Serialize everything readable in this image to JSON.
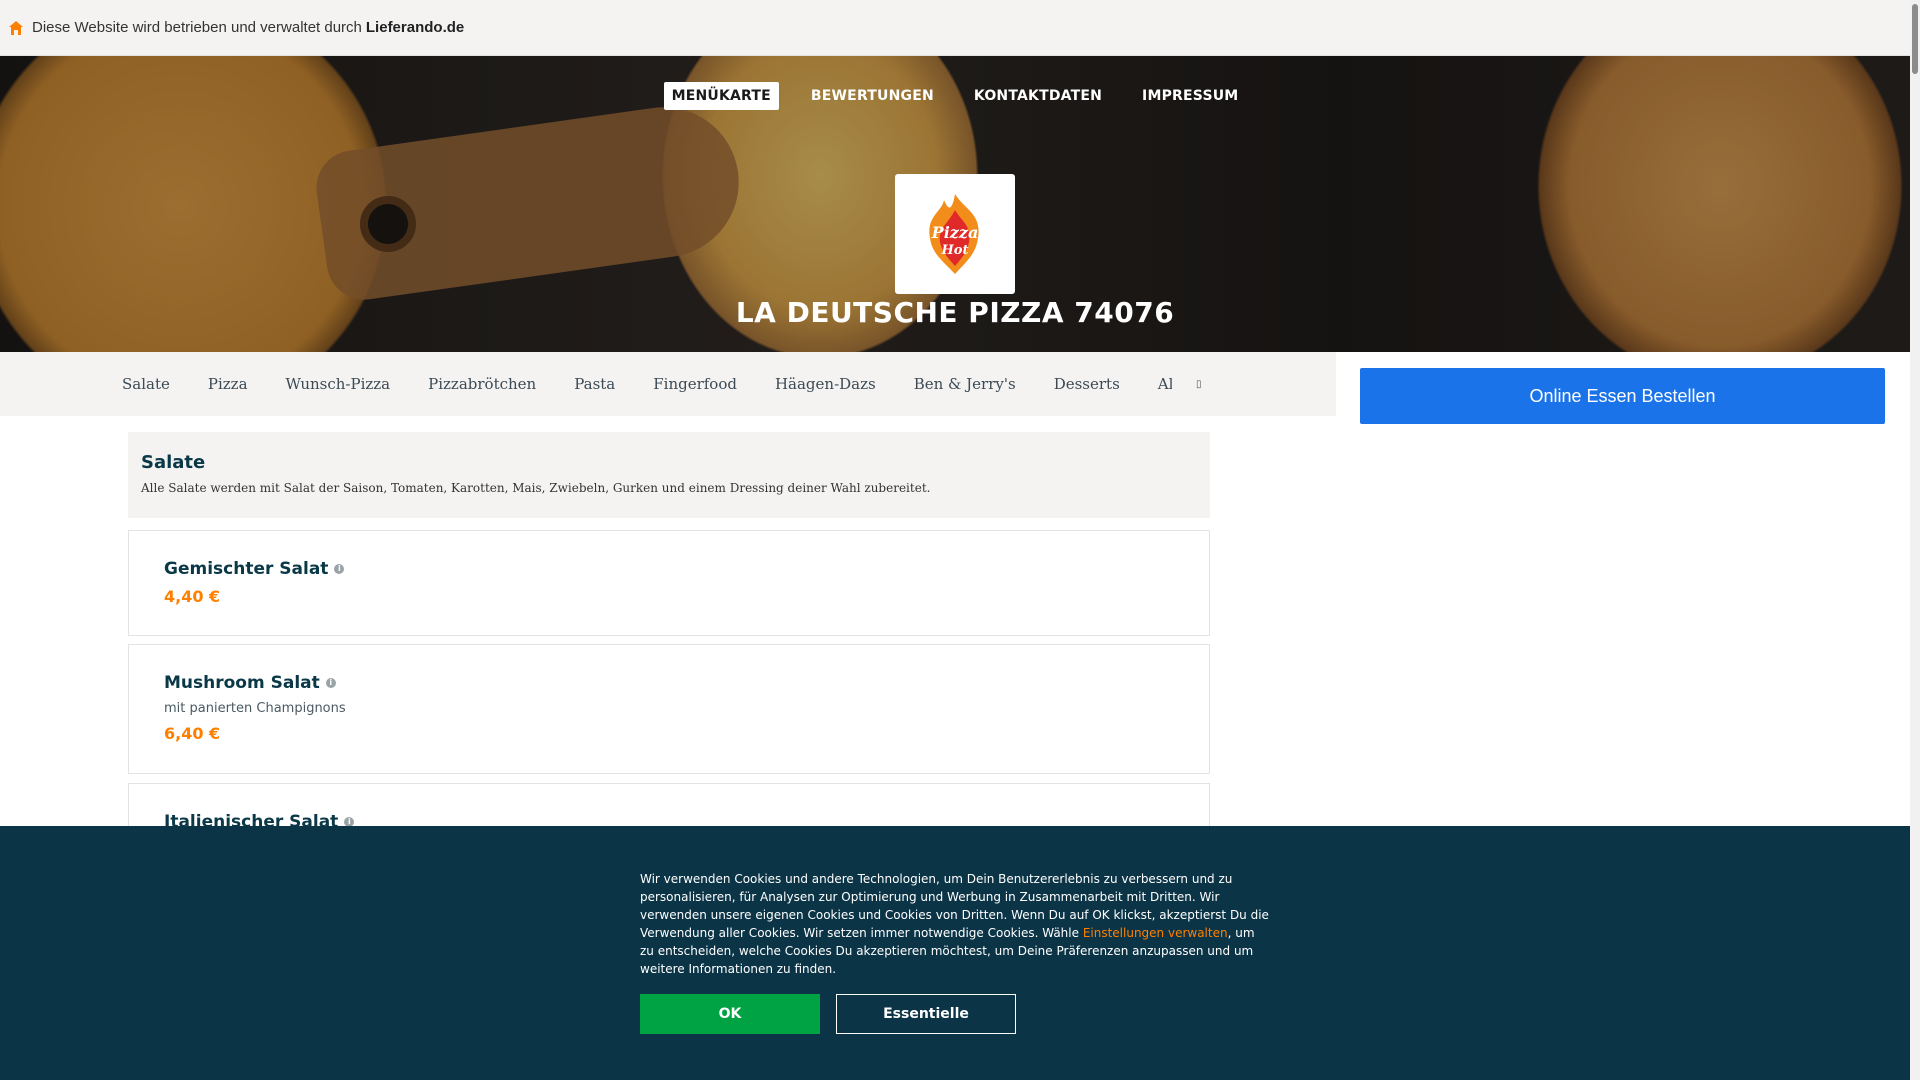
{
  "topbar": {
    "notice": "Diese Website wird betrieben und verwaltet durch",
    "brand": "Lieferando.de"
  },
  "nav": {
    "items": [
      {
        "label": "MENÜKARTE",
        "active": true
      },
      {
        "label": "BEWERTUNGEN",
        "active": false
      },
      {
        "label": "KONTAKTDATEN",
        "active": false
      },
      {
        "label": "IMPRESSUM",
        "active": false
      }
    ]
  },
  "restaurant": {
    "name": "LA DEUTSCHE PIZZA 74076",
    "logo_text_line1": "Pizza",
    "logo_text_line2": "Hot"
  },
  "categories": [
    "Salate",
    "Pizza",
    "Wunsch-Pizza",
    "Pizzabrötchen",
    "Pasta",
    "Fingerfood",
    "Häagen-Dazs",
    "Ben & Jerry's",
    "Desserts",
    "Alkoholfreie Ge"
  ],
  "order_button": "Online Essen Bestellen",
  "section": {
    "title": "Salate",
    "description": "Alle Salate werden mit Salat der Saison, Tomaten, Karotten, Mais, Zwiebeln, Gurken und einem Dressing deiner Wahl zubereitet."
  },
  "items": [
    {
      "name": "Gemischter Salat",
      "desc": "",
      "price": "4,40 €"
    },
    {
      "name": "Mushroom Salat",
      "desc": "mit panierten Champignons",
      "price": "6,40 €"
    },
    {
      "name": "Italienischer Salat",
      "desc": "",
      "price": ""
    }
  ],
  "cookie": {
    "text_before": "Wir verwenden Cookies und andere Technologien, um Dein Benutzererlebnis zu verbessern und zu personalisieren, für Analysen zur Optimierung und Werbung in Zusammenarbeit mit Dritten. Wir verwenden unsere eigenen Cookies und Cookies von Dritten. Wenn Du auf OK klickst, akzeptierst Du die Verwendung aller Cookies. Wir setzen immer notwendige Cookies. Wähle ",
    "link": "Einstellungen verwalten",
    "text_after": ", um zu entscheiden, welche Cookies Du akzeptieren möchtest, um Deine Präferenzen anzupassen und um weitere Informationen zu finden.",
    "ok": "OK",
    "essential": "Essentielle"
  },
  "colors": {
    "accent_orange": "#ff8000",
    "order_blue": "#1a73e8",
    "cookie_bg": "#0b3446",
    "ok_green": "#00a344"
  }
}
